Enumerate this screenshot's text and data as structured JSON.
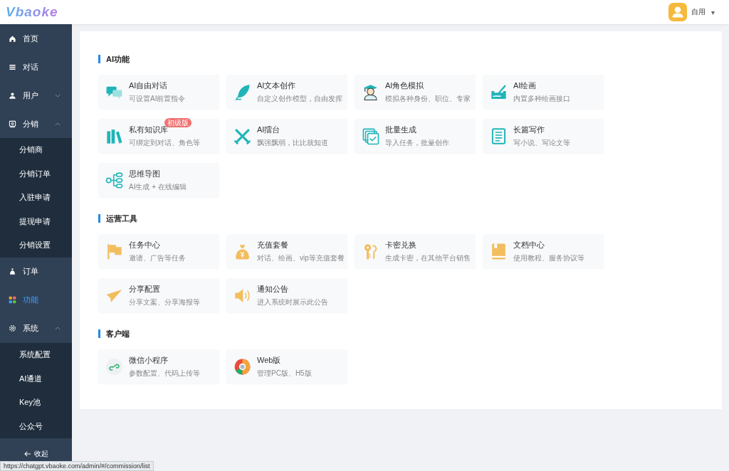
{
  "header": {
    "logo": "Vbaoke",
    "user": "自用",
    "user_menu_caret": "▾"
  },
  "sidebar": {
    "items": [
      {
        "label": "首页",
        "selected": false
      },
      {
        "label": "对话",
        "selected": false
      },
      {
        "label": "用户",
        "selected": false,
        "expanded": false
      },
      {
        "label": "分销",
        "selected": false,
        "expanded": true,
        "children": [
          {
            "label": "分销商",
            "selected": false
          },
          {
            "label": "分销订单",
            "selected": false
          },
          {
            "label": "入驻申请",
            "selected": false
          },
          {
            "label": "提现申请",
            "selected": false
          },
          {
            "label": "分销设置",
            "selected": false
          }
        ]
      },
      {
        "label": "订单",
        "selected": false
      },
      {
        "label": "功能",
        "selected": true
      },
      {
        "label": "系统",
        "selected": false,
        "expanded": true,
        "children": [
          {
            "label": "系统配置",
            "selected": false
          },
          {
            "label": "AI通道",
            "selected": false
          },
          {
            "label": "Key池",
            "selected": false
          },
          {
            "label": "公众号",
            "selected": false
          }
        ]
      }
    ],
    "collapse": "收起"
  },
  "sections": [
    {
      "title": "AI功能",
      "cards": [
        {
          "title": "AI自由对话",
          "description": "可设置AI前置指令"
        },
        {
          "title": "AI文本创作",
          "description": "自定义创作模型，自由发挥"
        },
        {
          "title": "AI角色模拟",
          "description": "模拟各种身份、职位、专家"
        },
        {
          "title": "AI绘画",
          "description": "内置多种绘画接口"
        },
        {
          "title": "私有知识库",
          "description": "可绑定到对话、角色等",
          "badge": "初级版"
        },
        {
          "title": "AI擂台",
          "description": "飘强飘弱，比比就知道"
        },
        {
          "title": "批量生成",
          "description": "导入任务，批量创作"
        },
        {
          "title": "长篇写作",
          "description": "写小说、写论文等"
        },
        {
          "title": "思维导图",
          "description": "AI生成 + 在线编辑"
        }
      ]
    },
    {
      "title": "运营工具",
      "cards": [
        {
          "title": "任务中心",
          "description": "邀请、广告等任务"
        },
        {
          "title": "充值套餐",
          "description": "对话、绘画、vip等充值套餐"
        },
        {
          "title": "卡密兑换",
          "description": "生成卡密，在其他平台销售"
        },
        {
          "title": "文档中心",
          "description": "使用教程、服务协议等"
        },
        {
          "title": "分享配置",
          "description": "分享文案、分享海报等"
        },
        {
          "title": "通知公告",
          "description": "进入系统时展示此公告"
        }
      ]
    },
    {
      "title": "客户端",
      "cards": [
        {
          "title": "微信小程序",
          "description": "参数配置、代码上传等"
        },
        {
          "title": "Web版",
          "description": "管理PC版、H5版"
        }
      ]
    }
  ],
  "status_url": "https://chatgpt.vbaoke.com/admin/#/commission/list"
}
